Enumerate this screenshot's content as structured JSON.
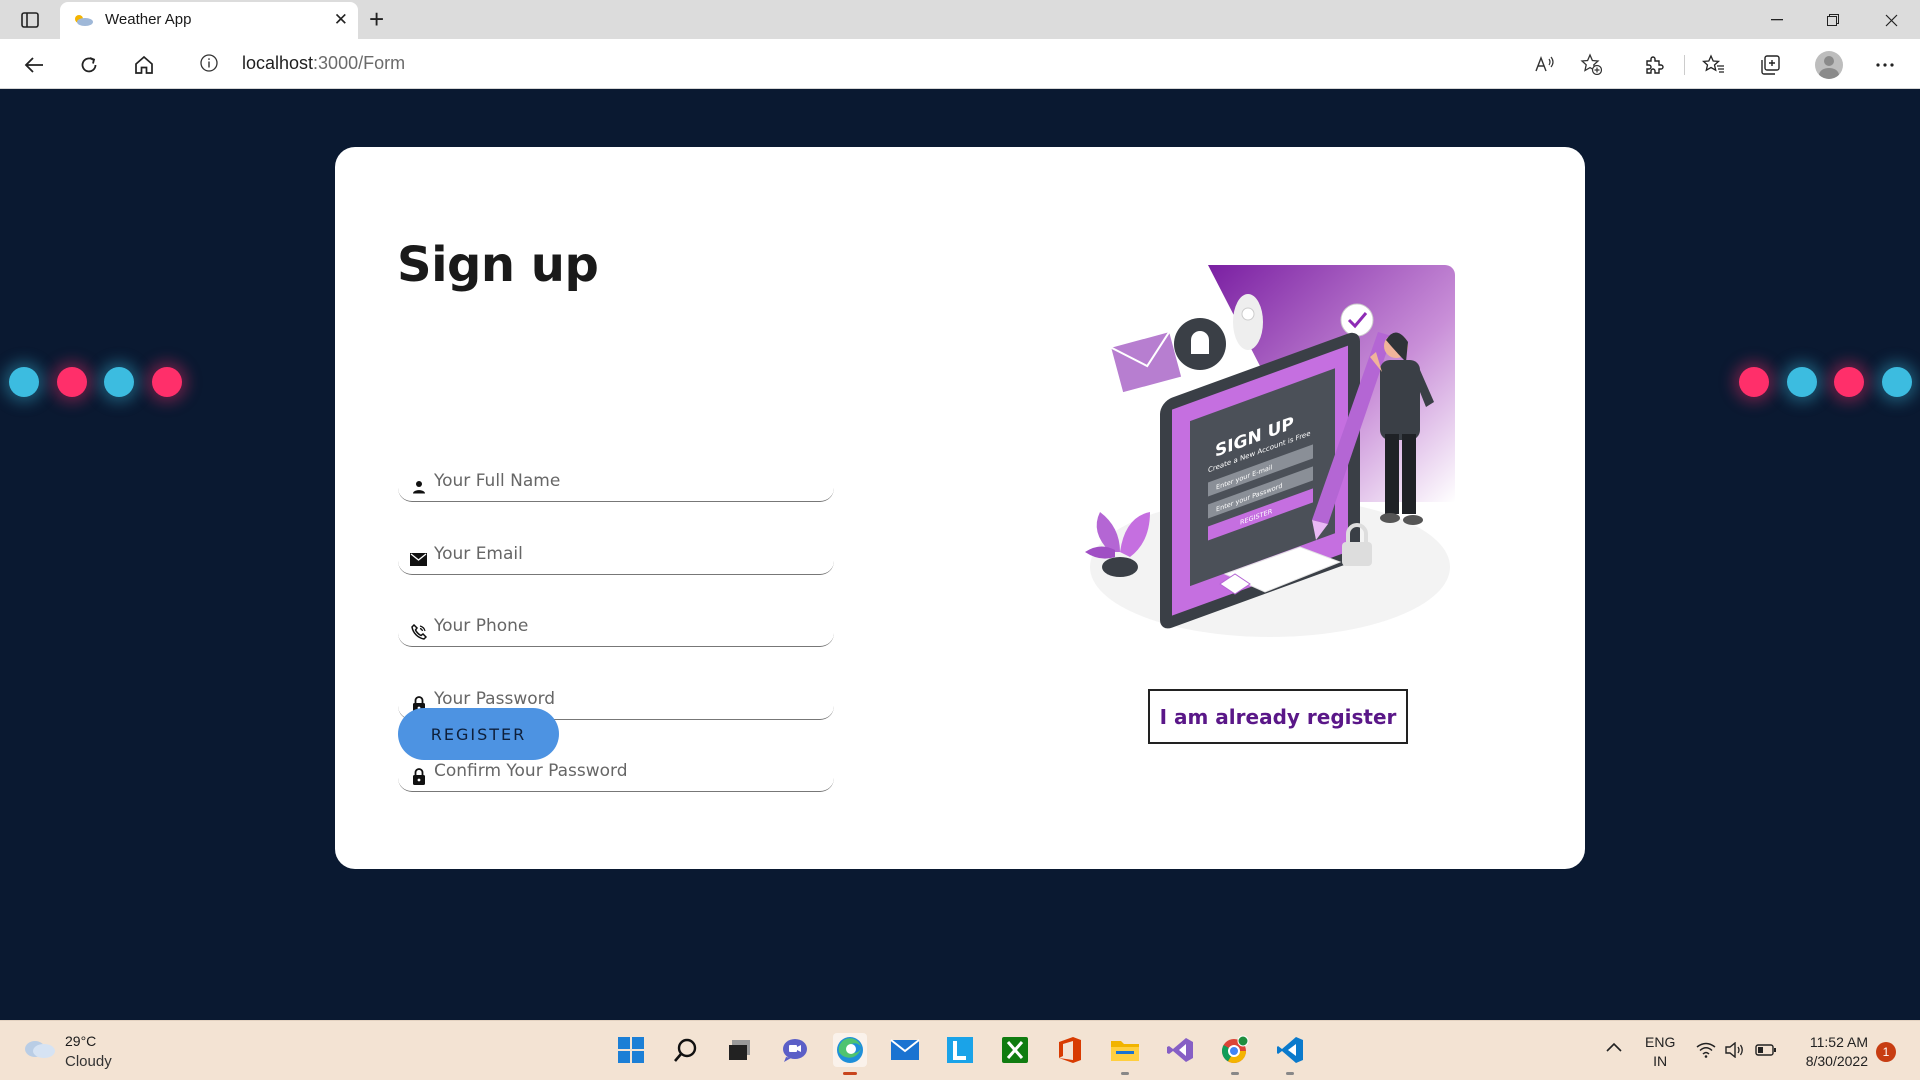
{
  "browser": {
    "tab_title": "Weather App",
    "tab_close": "✕",
    "new_tab": "+",
    "url_host": "localhost",
    "url_path": ":3000/Form"
  },
  "form": {
    "heading": "Sign up",
    "fields": [
      {
        "placeholder": "Your Full Name",
        "icon": "person-icon"
      },
      {
        "placeholder": "Your Email",
        "icon": "envelope-icon"
      },
      {
        "placeholder": "Your Phone",
        "icon": "phone-icon"
      },
      {
        "placeholder": "Your Password",
        "icon": "lock-icon"
      },
      {
        "placeholder": "Confirm Your Password",
        "icon": "lock-icon"
      }
    ],
    "register_label": "REGISTER",
    "login_link_label": "I am already register"
  },
  "illustration": {
    "title": "SIGN UP",
    "subtitle": "Create a New Account is Free",
    "email_placeholder": "Enter your E-mail",
    "password_placeholder": "Enter your Password",
    "button": "REGISTER"
  },
  "taskbar": {
    "weather_temp": "29°C",
    "weather_desc": "Cloudy",
    "lang_line1": "ENG",
    "lang_line2": "IN",
    "time": "11:52 AM",
    "date": "8/30/2022",
    "notification_count": "1"
  },
  "colors": {
    "page_bg": "#0a1931",
    "accent_button": "#4d93e2",
    "link_text": "#5a1788",
    "dot_blue": "#3cbce0",
    "dot_pink": "#ff2f6a",
    "illustration_purple": "#8e2bb5"
  }
}
